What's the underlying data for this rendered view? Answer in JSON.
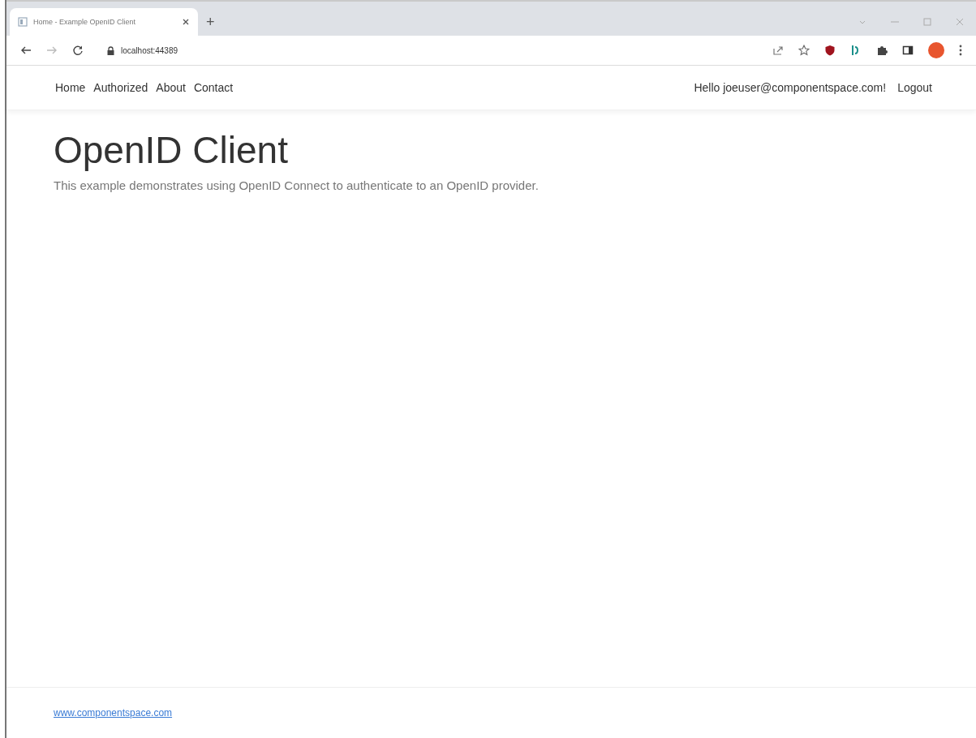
{
  "browser": {
    "tab": {
      "title": "Home - Example OpenID Client"
    },
    "new_tab": "+",
    "address": "localhost:44389"
  },
  "navbar": {
    "links": [
      {
        "label": "Home"
      },
      {
        "label": "Authorized"
      },
      {
        "label": "About"
      },
      {
        "label": "Contact"
      }
    ],
    "greeting": "Hello joeuser@componentspace.com!",
    "logout": "Logout"
  },
  "main": {
    "heading": "OpenID Client",
    "lead": "This example demonstrates using OpenID Connect to authenticate to an OpenID provider."
  },
  "footer": {
    "link": "www.componentspace.com"
  }
}
